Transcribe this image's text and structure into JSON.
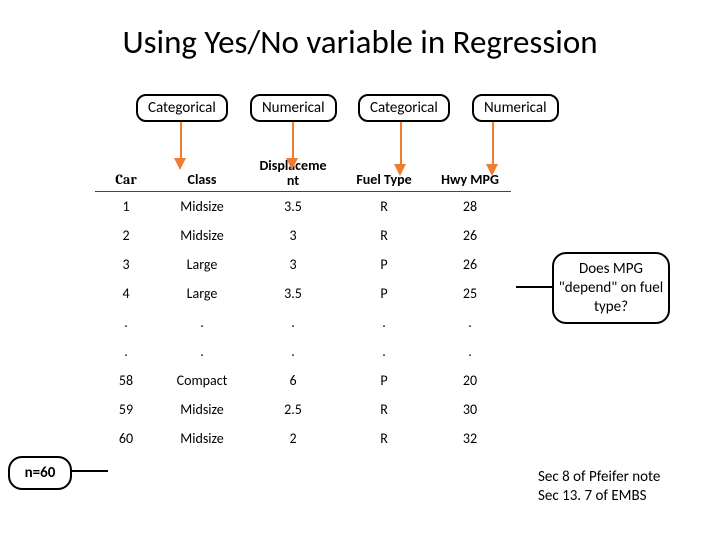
{
  "title": "Using Yes/No variable in Regression",
  "type_labels": [
    "Categorical",
    "Numerical",
    "Categorical",
    "Numerical"
  ],
  "headers": [
    "Car",
    "Class",
    "Displaceme\nnt",
    "Fuel Type",
    "Hwy MPG"
  ],
  "rows": [
    [
      "1",
      "Midsize",
      "3.5",
      "R",
      "28"
    ],
    [
      "2",
      "Midsize",
      "3",
      "R",
      "26"
    ],
    [
      "3",
      "Large",
      "3",
      "P",
      "26"
    ],
    [
      "4",
      "Large",
      "3.5",
      "P",
      "25"
    ],
    [
      ".",
      ".",
      ".",
      ".",
      "."
    ],
    [
      ".",
      ".",
      ".",
      ".",
      "."
    ],
    [
      "58",
      "Compact",
      "6",
      "P",
      "20"
    ],
    [
      "59",
      "Midsize",
      "2.5",
      "R",
      "30"
    ],
    [
      "60",
      "Midsize",
      "2",
      "R",
      "32"
    ]
  ],
  "n_label": "n=60",
  "question": "Does MPG \"depend\" on fuel type?",
  "refs": [
    "Sec 8 of Pfeifer note",
    "Sec 13. 7 of EMBS"
  ],
  "chart_data": {
    "type": "table",
    "title": "Using Yes/No variable in Regression",
    "columns": [
      "Car",
      "Class",
      "Displacement",
      "Fuel Type",
      "Hwy MPG"
    ],
    "column_types": [
      "Categorical",
      "Categorical",
      "Numerical",
      "Categorical",
      "Numerical"
    ],
    "n": 60,
    "rows_shown": [
      {
        "Car": 1,
        "Class": "Midsize",
        "Displacement": 3.5,
        "Fuel Type": "R",
        "Hwy MPG": 28
      },
      {
        "Car": 2,
        "Class": "Midsize",
        "Displacement": 3,
        "Fuel Type": "R",
        "Hwy MPG": 26
      },
      {
        "Car": 3,
        "Class": "Large",
        "Displacement": 3,
        "Fuel Type": "P",
        "Hwy MPG": 26
      },
      {
        "Car": 4,
        "Class": "Large",
        "Displacement": 3.5,
        "Fuel Type": "P",
        "Hwy MPG": 25
      },
      {
        "Car": 58,
        "Class": "Compact",
        "Displacement": 6,
        "Fuel Type": "P",
        "Hwy MPG": 20
      },
      {
        "Car": 59,
        "Class": "Midsize",
        "Displacement": 2.5,
        "Fuel Type": "R",
        "Hwy MPG": 30
      },
      {
        "Car": 60,
        "Class": "Midsize",
        "Displacement": 2,
        "Fuel Type": "R",
        "Hwy MPG": 32
      }
    ],
    "annotations": [
      "Does MPG \"depend\" on fuel type?",
      "Sec 8 of Pfeifer note",
      "Sec 13.7 of EMBS"
    ]
  }
}
